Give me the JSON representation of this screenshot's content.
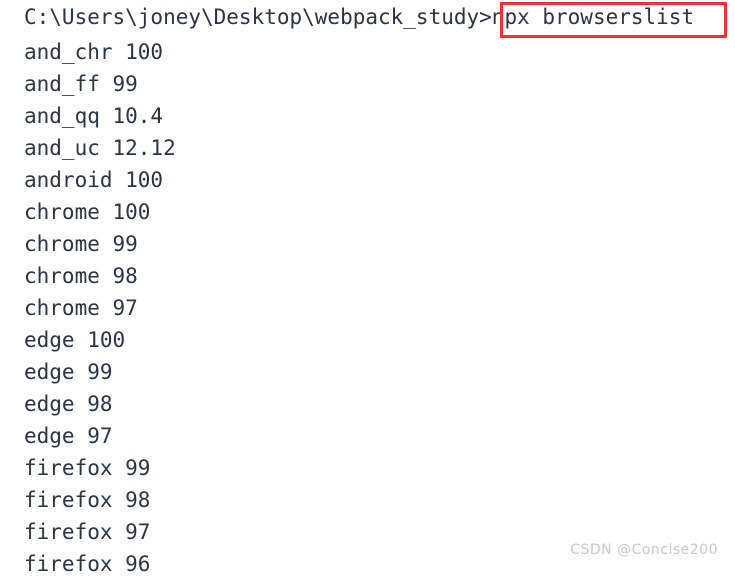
{
  "terminal": {
    "background_color": "#ffffff",
    "text_color": "#2b3440",
    "prompt": {
      "path": "C:\\Users\\joney\\Desktop\\webpack_study>",
      "command": "npx browserslist",
      "full_line": "C:\\Users\\joney\\Desktop\\webpack_study>npx browserslist"
    },
    "annotation": {
      "type": "rectangle",
      "color": "#ee3333",
      "target": "npx browserslist"
    },
    "output_lines": [
      "and_chr 100",
      "and_ff 99",
      "and_qq 10.4",
      "and_uc 12.12",
      "android 100",
      "chrome 100",
      "chrome 99",
      "chrome 98",
      "chrome 97",
      "edge 100",
      "edge 99",
      "edge 98",
      "edge 97",
      "firefox 99",
      "firefox 98",
      "firefox 97",
      "firefox 96"
    ]
  },
  "watermark": {
    "text": "CSDN @Concise200",
    "color": "#c9c9c9"
  }
}
